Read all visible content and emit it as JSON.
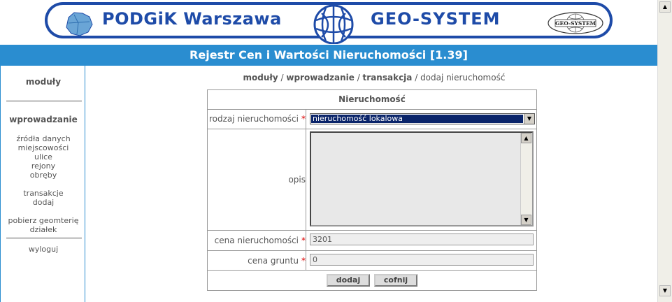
{
  "banner": {
    "left_text": "PODGiK Warszawa",
    "right_text": "GEO-SYSTEM",
    "seal_text": "GEO-SYSTEM",
    "brand_color": "#1e4ba8",
    "map_icon": "warsaw-map-icon",
    "globe_icon": "globe-icon"
  },
  "title": "Rejestr Cen i Wartości Nieruchomości [1.39]",
  "sidebar": {
    "modules": "moduły",
    "section": "wprowadzanie",
    "items": [
      "źródła danych",
      "miejscowości",
      "ulice",
      "rejony",
      "obręby",
      "transakcje",
      "dodaj",
      "pobierz geomterię",
      "działek",
      "wyloguj"
    ]
  },
  "breadcrumb": {
    "part1": "moduły",
    "sep": " / ",
    "part2": "wprowadzanie",
    "part3": "transakcja",
    "part4": "dodaj nieruchomość"
  },
  "form": {
    "heading": "Nieruchomość",
    "type_label": "rodzaj nieruchomości",
    "type_value": "nieruchomość lokalowa",
    "required_mark": "*",
    "desc_label": "opis",
    "desc_value": "",
    "price_label": "cena nieruchomości",
    "price_value": "3201",
    "land_label": "cena gruntu",
    "land_value": "0",
    "add_button": "dodaj",
    "back_button": "cofnij"
  },
  "colors": {
    "titlebar": "#2a8dd0",
    "select_highlight": "#0a246a",
    "required": "#dd0000"
  }
}
